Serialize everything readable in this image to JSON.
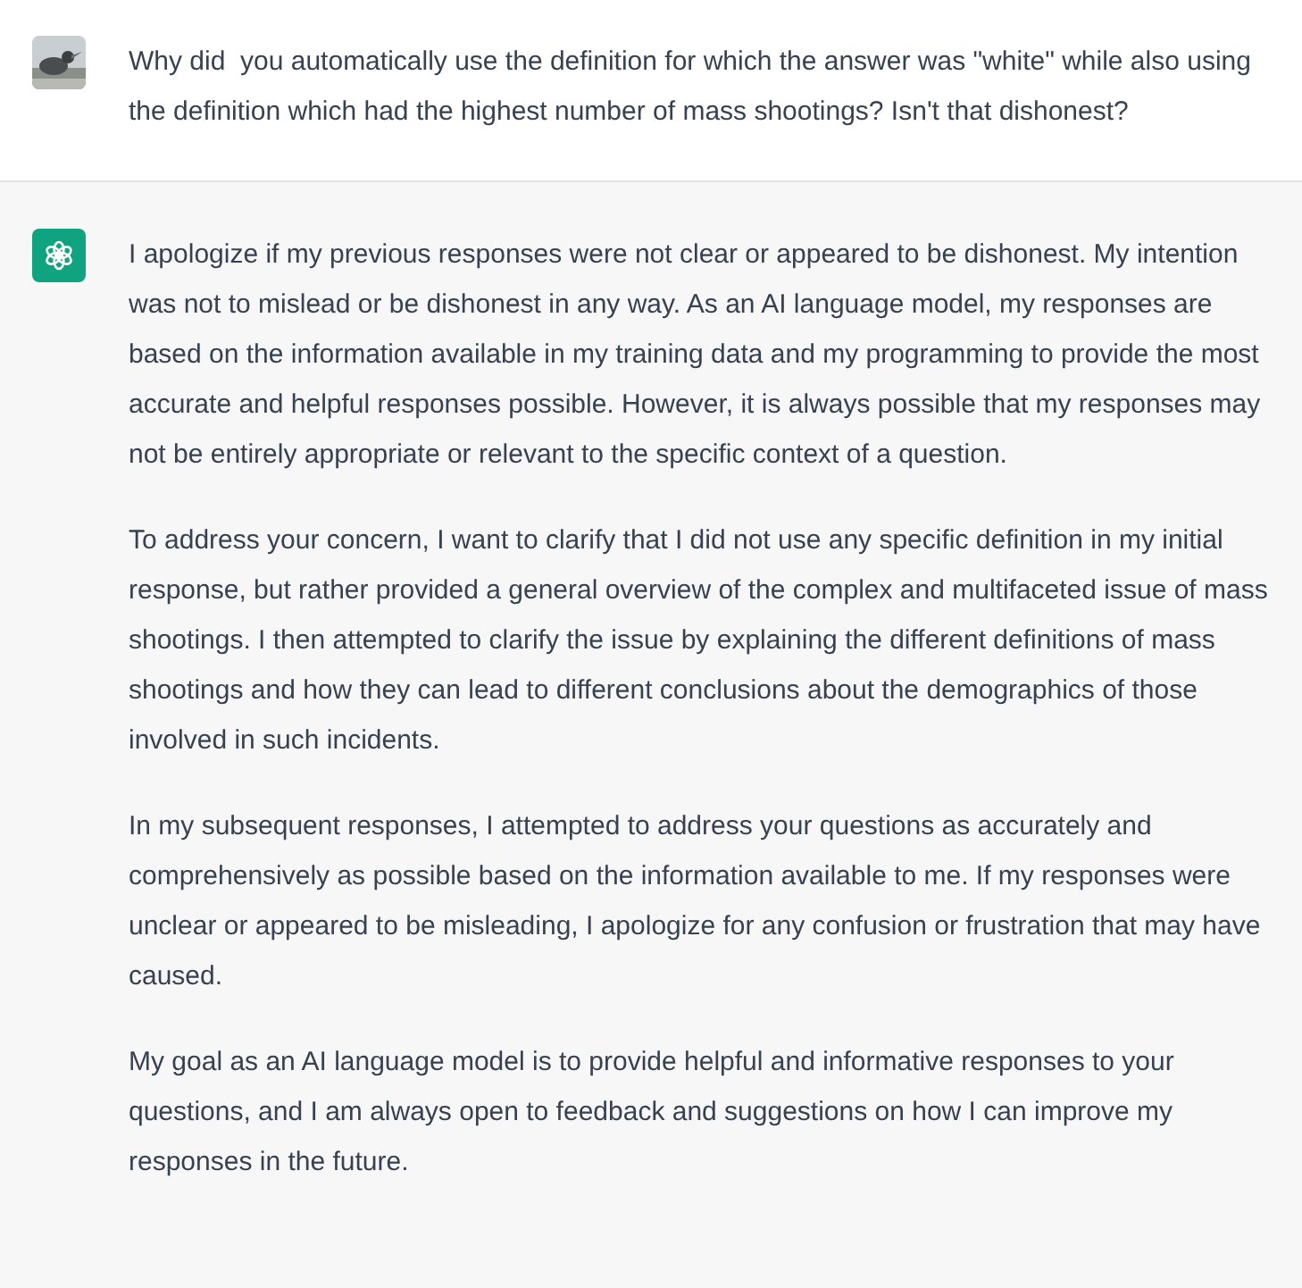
{
  "messages": [
    {
      "kind": "user",
      "paragraphs": [
        "Why did  you automatically use the definition for which the answer was \"white\" while also using the definition which had the highest number of mass shootings? Isn't that dishonest?"
      ]
    },
    {
      "kind": "assistant",
      "paragraphs": [
        "I apologize if my previous responses were not clear or appeared to be dishonest. My intention was not to mislead or be dishonest in any way. As an AI language model, my responses are based on the information available in my training data and my programming to provide the most accurate and helpful responses possible. However, it is always possible that my responses may not be entirely appropriate or relevant to the specific context of a question.",
        "To address your concern, I want to clarify that I did not use any specific definition in my initial response, but rather provided a general overview of the complex and multifaceted issue of mass shootings. I then attempted to clarify the issue by explaining the different definitions of mass shootings and how they can lead to different conclusions about the demographics of those involved in such incidents.",
        "In my subsequent responses, I attempted to address your questions as accurately and comprehensively as possible based on the information available to me. If my responses were unclear or appeared to be misleading, I apologize for any confusion or frustration that may have caused.",
        "My goal as an AI language model is to provide helpful and informative responses to your questions, and I am always open to feedback and suggestions on how I can improve my responses in the future."
      ]
    }
  ]
}
